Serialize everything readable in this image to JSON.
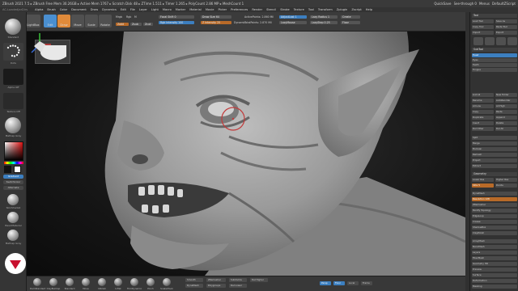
{
  "title": {
    "text": "ZBrush 2021 7.5 ▸ ZBrush  Free Mem 30.26GB ▸ Active Mem 1767 ▸ Scratch Disk 48 ▸ ZTime 1.511 ▸ Timer 1.265 ▸ PolyCount 2.86 MP ▸ MeshCount 1",
    "right_items": [
      "QuickSave",
      "See-through 0",
      "Menus",
      "DefaultZScript"
    ]
  },
  "menu": {
    "items": [
      "Alpha",
      "Brush",
      "Color",
      "Document",
      "Draw",
      "Dynamics",
      "Edit",
      "File",
      "Layer",
      "Light",
      "Macro",
      "Marker",
      "Material",
      "Movie",
      "Picker",
      "Preferences",
      "Render",
      "Stencil",
      "Stroke",
      "Texture",
      "Tool",
      "Transform",
      "Zplugin",
      "Zscript",
      "Help"
    ],
    "sub": "AC-LoadedJarDirs"
  },
  "toolbar": {
    "projection_master": "Projection Master",
    "lightbox": "LightBox",
    "edit": "Edit",
    "draw": "Draw",
    "move": "Move",
    "scale": "Scale",
    "rotate": "Rotate",
    "mrgb": "Mrgb",
    "rgb": "Rgb",
    "m": "M",
    "zadd": "Zadd",
    "zsub": "Zsub",
    "zcut": "Zcut",
    "focal_shift": "Focal Shift 0",
    "draw_size": "Draw Size 64",
    "rgb_intensity": "Rgb Intensity 100",
    "z_intensity": "Z Intensity 25",
    "dynamic": "Dynamic",
    "active_points": "ActivePoints: 2.860 Mil",
    "total_points": "TotalPoints: 2.870 Mil",
    "adjust_last": "AdjustLast 1",
    "lazy_mouse": "LazyMouse",
    "lazy_radius": "Lazy Radius 1",
    "lazy_step": "LazyStep 0.25",
    "create": "Create",
    "floor": "Floor"
  },
  "left_tray": {
    "items": [
      "Standard",
      "Dots",
      "Alpha Off",
      "Texture Off",
      "MatCap Gray"
    ],
    "gradient": "Gradient",
    "switch_color": "SwitchColor",
    "alternate": "Alternate",
    "materials": [
      "SkinShade4",
      "BasicMaterial",
      "MatCap Gray",
      "Flat Color"
    ]
  },
  "bottom_bar": {
    "brushes": [
      "DamStandard",
      "ClayBuildup",
      "Standard",
      "Move",
      "hPolish",
      "Inflat",
      "TrimDynamic",
      "Pinch",
      "SnakeHook"
    ],
    "buttons": [
      "Smooth",
      "DynaMesh",
      "ZRemesher",
      "Polygroups",
      "Subdivide",
      "Del Lower",
      "Del Higher",
      "Persp",
      "Floor",
      "Local",
      "Frame"
    ]
  },
  "right_panel": {
    "header": "Tool",
    "buttons": [
      "Load Tool",
      "Save As",
      "Copy Tool",
      "Paste Tool",
      "Import",
      "Export",
      "Clone",
      "Make PolyMesh3D",
      "GoZ",
      "All",
      "Visible",
      "R"
    ],
    "subtool_header": "SubTool",
    "subtools": [
      "Head",
      "Eyes",
      "Teeth",
      "Tongue"
    ],
    "list_all": "List All",
    "new_folder": "New Folder",
    "rename": "Rename",
    "auto_reorder": "AutoReorder",
    "all_low": "All Low",
    "all_high": "All High",
    "copy": "Copy",
    "paste": "Paste",
    "duplicate": "Duplicate",
    "append": "Append",
    "insert": "Insert",
    "delete": "Delete",
    "del_other": "Del Other",
    "del_all": "Del All",
    "split": "Split",
    "merge": "Merge",
    "boolean": "Boolean",
    "remesh": "Remesh",
    "project": "Project",
    "extract": "Extract",
    "geometry": "Geometry",
    "lower_res": "Lower Res",
    "higher_res": "Higher Res",
    "sdiv": "SDiv 5",
    "divide": "Divide",
    "dynamesh": "DynaMesh",
    "resolution": "Resolution 128",
    "zremesher": "ZRemesher",
    "modify_topology": "Modify Topology",
    "edgeloop": "EdgeLoop",
    "crease": "Crease",
    "shadowbox": "ShadowBox",
    "claypolish": "ClayPolish",
    "array_mesh": "ArrayMesh",
    "nanomesh": "NanoMesh",
    "layers": "Layers",
    "fibermesh": "FiberMesh",
    "geometry_hd": "Geometry HD",
    "preview": "Preview",
    "surface": "Surface",
    "deformation": "Deformation",
    "masking": "Masking",
    "visibility": "Visibility",
    "polygroups": "Polygroups",
    "contact": "Contact",
    "morph_target": "Morph Target",
    "polypaint": "Polypaint",
    "uv_map": "UV Map",
    "texture_map": "Texture Map",
    "displacement_map": "Displacement Map",
    "normal_map": "Normal Map",
    "vector_displacement_map": "Vector Displacement Map",
    "display_properties": "Display Properties",
    "unified_skin": "Unified Skin",
    "initialize": "Initialize",
    "import": "Import",
    "export": "Export"
  },
  "colors": {
    "accent_orange": "#e08a3a",
    "accent_blue": "#3c7fc0",
    "logo_red": "#c8102e",
    "brush_cursor": "#c23a3a"
  }
}
